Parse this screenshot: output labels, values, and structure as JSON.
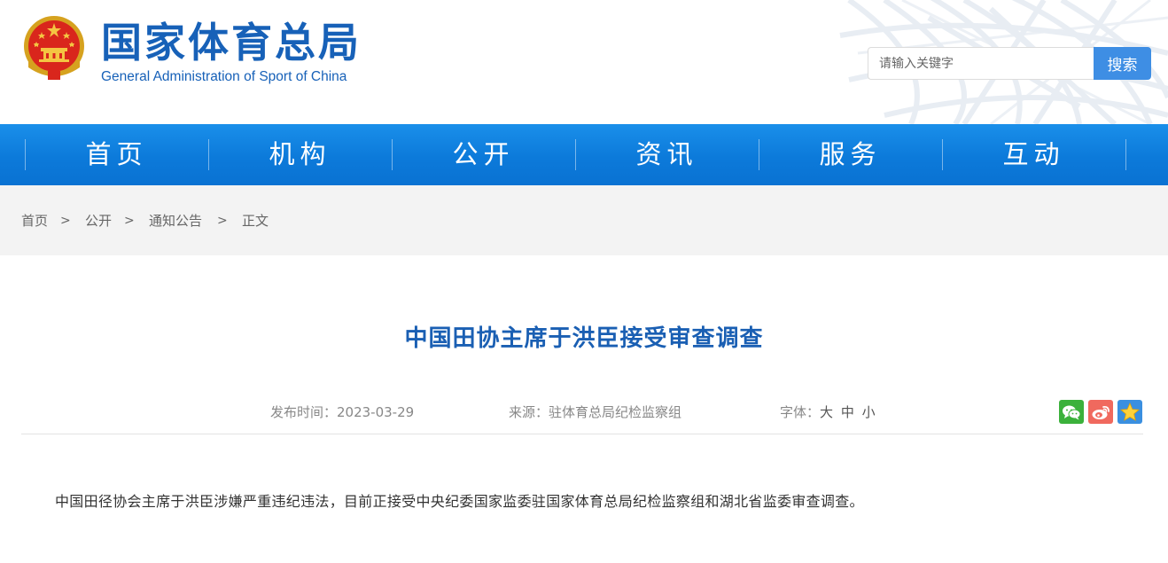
{
  "header": {
    "logo_cn": "国家体育总局",
    "logo_en": "General Administration of Sport of China",
    "emblem_icon": "national-emblem-icon"
  },
  "search": {
    "placeholder": "请输入关键字",
    "button_label": "搜索"
  },
  "nav": {
    "items": [
      {
        "label": "首页"
      },
      {
        "label": "机构"
      },
      {
        "label": "公开"
      },
      {
        "label": "资讯"
      },
      {
        "label": "服务"
      },
      {
        "label": "互动"
      }
    ]
  },
  "breadcrumb": {
    "items": [
      {
        "label": "首页"
      },
      {
        "label": "公开"
      },
      {
        "label": "通知公告"
      },
      {
        "label": "正文"
      }
    ],
    "separator": ">"
  },
  "article": {
    "title": "中国田协主席于洪臣接受审查调查",
    "publish_time": "发布时间：2023-03-29",
    "source": "来源：驻体育总局纪检监察组",
    "font_size_label": "字体：",
    "font_sizes": [
      "大",
      "中",
      "小"
    ],
    "body": "中国田径协会主席于洪臣涉嫌严重违纪违法，目前正接受中央纪委国家监委驻国家体育总局纪检监察组和湖北省监委审查调查。"
  },
  "share": {
    "icons": [
      "wechat-icon",
      "weibo-icon",
      "favorite-star-icon"
    ]
  },
  "colors": {
    "brand_blue": "#1761b8",
    "nav_blue": "#0c7ada",
    "title_blue": "#1a5fb3",
    "search_button": "#3e8ee4",
    "wechat_green": "#3bb13b",
    "weibo_red": "#f0695e",
    "favorite_blue": "#3a8fe0"
  }
}
